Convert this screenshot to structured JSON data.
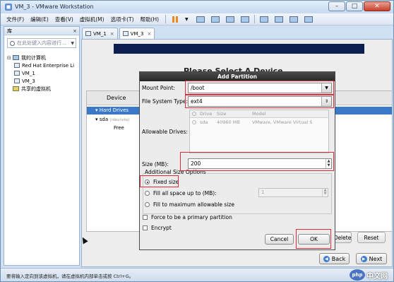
{
  "window": {
    "title": "VM_3 - VMware Workstation",
    "buttons": {
      "minimize": "–",
      "maximize": "□",
      "close": "✕"
    }
  },
  "menubar": {
    "items": [
      "文件(F)",
      "编辑(E)",
      "查看(V)",
      "虚拟机(M)",
      "选项卡(T)",
      "帮助(H)"
    ]
  },
  "library": {
    "title": "库",
    "close": "×",
    "search_placeholder": "在此处键入内容进行...",
    "tree": {
      "root": "我的计算机",
      "children": [
        "Red Hat Enterprise Li",
        "VM_1",
        "VM_3"
      ],
      "shared": "共享的虚拟机"
    }
  },
  "tabs": [
    {
      "label": "VM_1",
      "close": "×"
    },
    {
      "label": "VM_3",
      "close": "×"
    }
  ],
  "installer": {
    "heading": "Please Select A Device",
    "device_column": "Device",
    "hard_drives": "Hard Drives",
    "sda": "sda",
    "sda_path": "(/dev/sda)",
    "free": "Free",
    "buttons": {
      "delete": "Delete",
      "reset": "Reset",
      "back": "Back",
      "next": "Next"
    }
  },
  "dialog": {
    "title": "Add Partition",
    "mount_point_label": "Mount Point:",
    "mount_point_value": "/boot",
    "fs_type_label": "File System Type:",
    "fs_type_value": "ext4",
    "allowable_drives_label": "Allowable Drives:",
    "drives_table": {
      "headers": [
        "",
        "Drive",
        "Size",
        "Model"
      ],
      "rows": [
        [
          "",
          "sda",
          "40960 MB",
          "VMware, VMware Virtual S"
        ]
      ]
    },
    "size_label": "Size (MB):",
    "size_value": "200",
    "options_group_title": "Additional Size Options",
    "options": {
      "fixed": "Fixed size",
      "fill_upto": "Fill all space up to (MB):",
      "fill_upto_value": "1",
      "fill_max": "Fill to maximum allowable size"
    },
    "selected_option": "fixed",
    "force_primary": "Force to be a primary partition",
    "encrypt": "Encrypt",
    "cancel": "Cancel",
    "ok": "OK"
  },
  "statusbar": {
    "text": "要将输入定向到该虚拟机，请在虚拟机内部单击或按 Ctrl+G。",
    "watermark_badge": "php",
    "watermark_text": "中文网"
  },
  "colors": {
    "highlight": "#e3283a",
    "selection": "#3b78c8",
    "banner": "#0c1f4f"
  }
}
